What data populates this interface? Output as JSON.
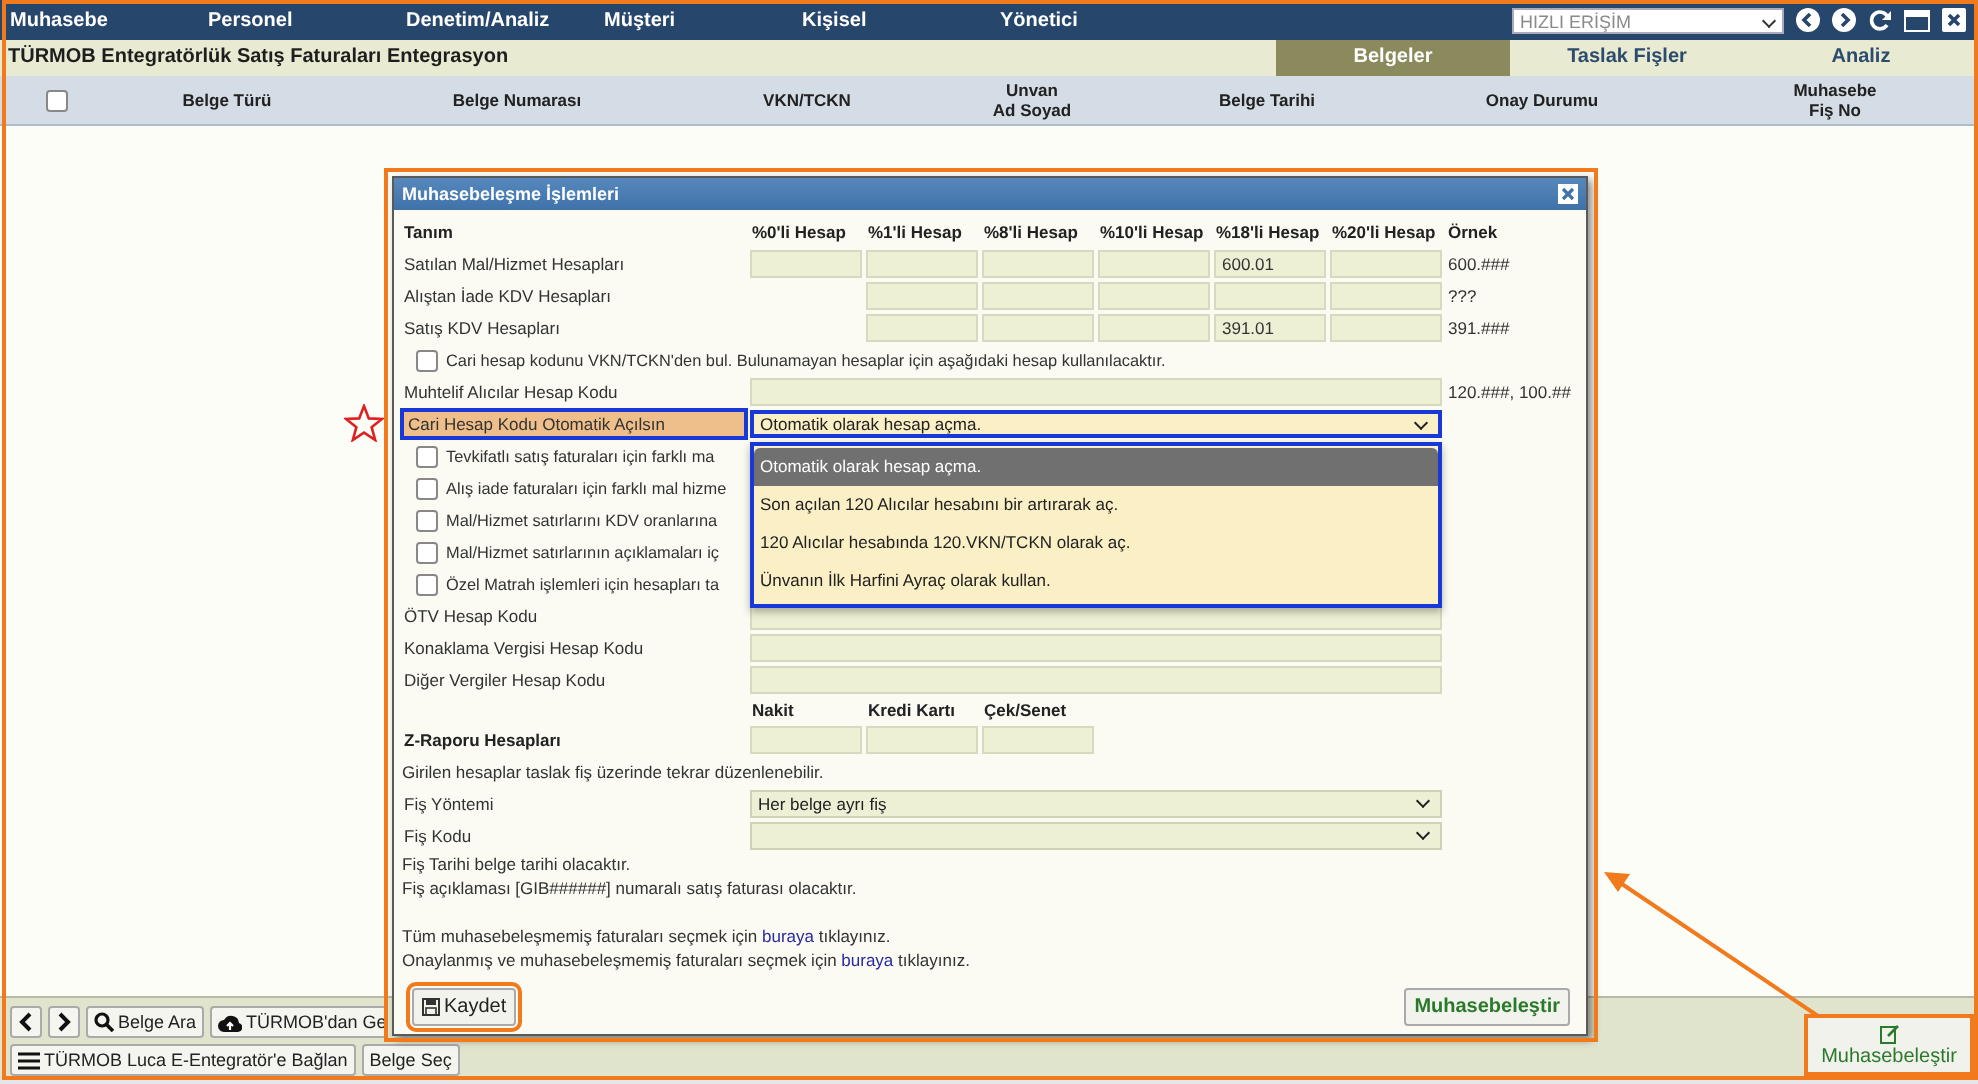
{
  "menu": [
    "Muhasebe",
    "Personel",
    "Denetim/Analiz",
    "Müşteri",
    "Kişisel",
    "Yönetici"
  ],
  "quick_access": {
    "placeholder": "HIZLI ERİŞİM"
  },
  "page_title": "TÜRMOB Entegratörlük Satış Faturaları Entegrasyon",
  "tabs": [
    {
      "label": "Belgeler",
      "selected": true
    },
    {
      "label": "Taslak Fişler",
      "selected": false
    },
    {
      "label": "Analiz",
      "selected": false
    }
  ],
  "table": {
    "select_all_checked": false,
    "columns": [
      {
        "lines": [
          "Belge Türü"
        ]
      },
      {
        "lines": [
          "Belge Numarası"
        ]
      },
      {
        "lines": [
          "VKN/TCKN"
        ]
      },
      {
        "lines": [
          "Unvan",
          "Ad Soyad"
        ]
      },
      {
        "lines": [
          "Belge Tarihi"
        ]
      },
      {
        "lines": [
          "Onay Durumu"
        ]
      },
      {
        "lines": [
          "Muhasebe",
          "Fiş No"
        ]
      }
    ]
  },
  "toolbar": {
    "rows": [
      [
        {
          "kind": "prev"
        },
        {
          "kind": "next"
        },
        {
          "kind": "search",
          "label": "Belge Ara"
        },
        {
          "kind": "cloud",
          "label": "TÜRMOB'dan Ge"
        }
      ],
      [
        {
          "kind": "list",
          "label": "TÜRMOB Luca E-Entegratör'e Bağlan"
        },
        {
          "kind": "plain",
          "label": "Belge Seç"
        }
      ]
    ]
  },
  "action_button": {
    "label": "Muhasebeleştir"
  },
  "dialog": {
    "title": "Muhasebeleşme İşlemleri",
    "rows": [
      {
        "kind": "header",
        "cells": [
          "Tanım",
          "%0'li Hesap",
          "%1'li Hesap",
          "%8'li Hesap",
          "%10'li Hesap",
          "%18'li Hesap",
          "%20'li Hesap",
          "Örnek"
        ]
      },
      {
        "kind": "accounts",
        "label": "Satılan Mal/Hizmet Hesapları",
        "cells": [
          {
            "kind": "field"
          },
          {
            "kind": "field"
          },
          {
            "kind": "field"
          },
          {
            "kind": "field"
          },
          {
            "kind": "field",
            "value": "600.01"
          },
          {
            "kind": "field"
          }
        ],
        "example": "600.###"
      },
      {
        "kind": "accounts",
        "label": "Alıştan İade KDV Hesapları",
        "cells": [
          {
            "kind": "none"
          },
          {
            "kind": "field"
          },
          {
            "kind": "field"
          },
          {
            "kind": "field"
          },
          {
            "kind": "field"
          },
          {
            "kind": "field"
          }
        ],
        "example": "???"
      },
      {
        "kind": "accounts",
        "label": "Satış KDV Hesapları",
        "cells": [
          {
            "kind": "none"
          },
          {
            "kind": "field"
          },
          {
            "kind": "field"
          },
          {
            "kind": "field"
          },
          {
            "kind": "field",
            "value": "391.01"
          },
          {
            "kind": "field"
          }
        ],
        "example": "391.###"
      },
      {
        "kind": "checkbox",
        "label": "Cari hesap kodunu VKN/TCKN'den bul. Bulunamayan hesaplar için aşağıdaki hesap kullanılacaktır.",
        "checked": false
      },
      {
        "kind": "field",
        "label": "Muhtelif Alıcılar Hesap Kodu",
        "example": "120.###, 100.##"
      },
      {
        "kind": "select",
        "label": "Cari Hesap Kodu Otomatik Açılsın",
        "value": "Otomatik olarak hesap açma.",
        "highlighted": true,
        "expanded": true,
        "options": [
          {
            "label": "Otomatik olarak hesap açma.",
            "selected": true
          },
          {
            "label": "Son açılan 120 Alıcılar hesabını bir artırarak aç.",
            "selected": false
          },
          {
            "label": "120 Alıcılar hesabında 120.VKN/TCKN olarak aç.",
            "selected": false
          },
          {
            "label": "Ünvanın İlk Harfini Ayraç olarak kullan.",
            "selected": false
          }
        ]
      },
      {
        "kind": "checkbox",
        "label": "Tevkifatlı satış faturaları için farklı ma",
        "checked": false
      },
      {
        "kind": "checkbox",
        "label": "Alış iade faturaları için farklı mal hizme",
        "checked": false
      },
      {
        "kind": "checkbox",
        "label": "Mal/Hizmet satırlarını KDV oranlarına",
        "checked": false
      },
      {
        "kind": "checkbox",
        "label": "Mal/Hizmet satırlarının açıklamaları iç",
        "checked": false
      },
      {
        "kind": "checkbox",
        "label": "Özel Matrah işlemleri için hesapları ta",
        "checked": false
      },
      {
        "kind": "field",
        "label": "ÖTV Hesap Kodu"
      },
      {
        "kind": "field",
        "label": "Konaklama Vergisi Hesap Kodu"
      },
      {
        "kind": "field",
        "label": "Diğer Vergiler Hesap Kodu"
      },
      {
        "kind": "subheader",
        "cells": [
          "Nakit",
          "Kredi Kartı",
          "Çek/Senet"
        ]
      },
      {
        "kind": "accounts",
        "label": "Z-Raporu Hesapları",
        "bold": true,
        "cells": [
          {
            "kind": "field"
          },
          {
            "kind": "field"
          },
          {
            "kind": "field"
          }
        ]
      },
      {
        "kind": "text",
        "text": "Girilen hesaplar taslak fiş üzerinde tekrar düzenlenebilir."
      },
      {
        "kind": "select",
        "label": "Fiş Yöntemi",
        "value": "Her belge ayrı fiş",
        "highlighted": false,
        "expanded": false
      },
      {
        "kind": "select",
        "label": "Fiş Kodu",
        "highlighted": false,
        "expanded": false
      },
      {
        "kind": "text",
        "text": "Fiş Tarihi belge tarihi olacaktır."
      },
      {
        "kind": "text",
        "text": "Fiş açıklaması [GIB######] numaralı satış faturası olacaktır."
      },
      {
        "kind": "link_text",
        "before": "Tüm muhasebeleşmemiş faturaları seçmek için ",
        "link": "buraya",
        "after": " tıklayınız."
      },
      {
        "kind": "link_text",
        "before": "Onaylanmış ve muhasebeleşmemiş faturaları seçmek için ",
        "link": "buraya",
        "after": " tıklayınız."
      }
    ],
    "buttons": [
      {
        "kind": "save",
        "label": "Kaydet"
      },
      {
        "kind": "post",
        "label": "Muhasebeleştir"
      }
    ]
  }
}
